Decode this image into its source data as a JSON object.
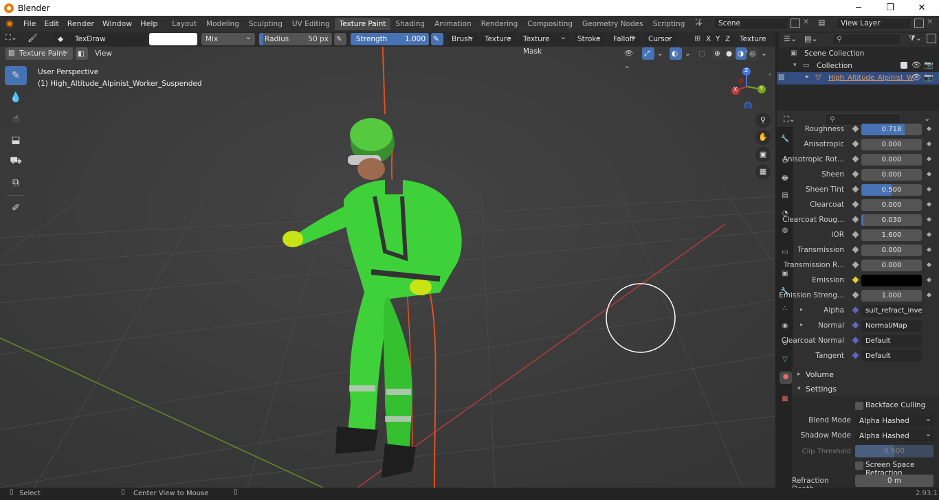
{
  "window": {
    "title": "Blender",
    "minimize": "─",
    "maximize": "❐",
    "close": "✕"
  },
  "menus": [
    "File",
    "Edit",
    "Render",
    "Window",
    "Help"
  ],
  "workspaces": [
    "Layout",
    "Modeling",
    "Sculpting",
    "UV Editing",
    "Texture Paint",
    "Shading",
    "Animation",
    "Rendering",
    "Compositing",
    "Geometry Nodes",
    "Scripting"
  ],
  "active_workspace": "Texture Paint",
  "scene": {
    "name": "Scene",
    "view_layer": "View Layer"
  },
  "tool_header": {
    "brush": "TexDraw",
    "blend": "Mix",
    "radius_label": "Radius",
    "radius_value": "50 px",
    "strength_label": "Strength",
    "strength_value": "1.000",
    "strength_level": 1.0,
    "menus": [
      "Brush",
      "Texture",
      "Texture Mask",
      "Stroke",
      "Falloff",
      "Cursor"
    ],
    "axes": [
      "X",
      "Y",
      "Z"
    ],
    "texture_slots": "Texture Slots"
  },
  "view_header": {
    "mode": "Texture Paint",
    "view": "View"
  },
  "viewport": {
    "perspective": "User Perspective",
    "object": "(1) High_Altitude_Alpinist_Worker_Suspended"
  },
  "gizmo": {
    "x": "X",
    "y": "Y",
    "z": "Z"
  },
  "outliner": {
    "root": "Scene Collection",
    "collection": "Collection",
    "object": "High_Altitude_Alpinist_W"
  },
  "properties": [
    {
      "label": "Roughness",
      "value": "0.718",
      "fill": 0.718
    },
    {
      "label": "Anisotropic",
      "value": "0.000",
      "fill": 0
    },
    {
      "label": "Anisotropic Rot...",
      "value": "0.000",
      "fill": 0
    },
    {
      "label": "Sheen",
      "value": "0.000",
      "fill": 0
    },
    {
      "label": "Sheen Tint",
      "value": "0.500",
      "fill": 0.5
    },
    {
      "label": "Clearcoat",
      "value": "0.000",
      "fill": 0
    },
    {
      "label": "Clearcoat Roug...",
      "value": "0.030",
      "fill": 0.03
    },
    {
      "label": "IOR",
      "value": "1.600",
      "fill": 0
    },
    {
      "label": "Transmission",
      "value": "0.000",
      "fill": 0
    },
    {
      "label": "Transmission R...",
      "value": "0.000",
      "fill": 0
    },
    {
      "label": "Emission",
      "value": "",
      "fill": 0
    },
    {
      "label": "Emission Streng...",
      "value": "1.000",
      "fill": 0
    },
    {
      "label": "Alpha",
      "value": "suit_refract_invert.pn",
      "fill": 0
    },
    {
      "label": "Normal",
      "value": "Normal/Map",
      "fill": 0
    },
    {
      "label": "Clearcoat Normal",
      "value": "Default",
      "fill": 0
    },
    {
      "label": "Tangent",
      "value": "Default",
      "fill": 0
    }
  ],
  "panels": {
    "volume": "Volume",
    "settings": "Settings"
  },
  "settings": {
    "backface": "Backface Culling",
    "blend_mode_label": "Blend Mode",
    "blend_mode": "Alpha Hashed",
    "shadow_mode_label": "Shadow Mode",
    "shadow_mode": "Alpha Hashed",
    "clip_label": "Clip Threshold",
    "clip_value": "0.500",
    "ssr": "Screen Space Refraction",
    "refraction_label": "Refraction Depth",
    "refraction_value": "0 m"
  },
  "status": {
    "select": "Select",
    "center": "Center View to Mouse",
    "version": "2.93.1"
  },
  "colors": {
    "accent": "#4772b3",
    "suit": "#3fd13a",
    "rope": "#e0521f",
    "xaxis": "#c0393c",
    "yaxis": "#7ea321"
  }
}
